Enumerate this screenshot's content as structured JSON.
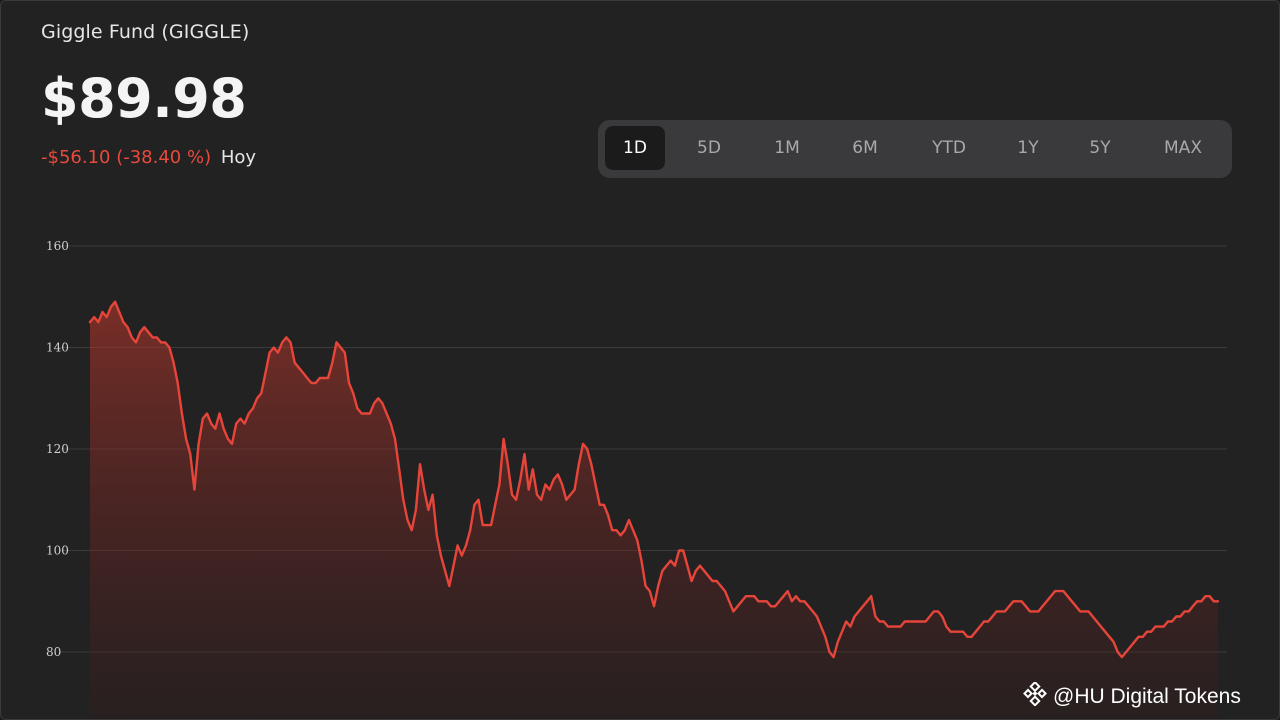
{
  "header": {
    "fund_name": "Giggle Fund (GIGGLE)",
    "price": "$89.98",
    "change": "-$56.10 (-38.40 %)",
    "period": "Hoy"
  },
  "ranges": [
    {
      "label": "1D",
      "active": true
    },
    {
      "label": "5D",
      "active": false
    },
    {
      "label": "1M",
      "active": false
    },
    {
      "label": "6M",
      "active": false
    },
    {
      "label": "YTD",
      "active": false
    },
    {
      "label": "1Y",
      "active": false
    },
    {
      "label": "5Y",
      "active": false
    },
    {
      "label": "MAX",
      "active": false
    }
  ],
  "colors": {
    "line": "#e8453a",
    "negative": "#e84a3c",
    "background": "#222223",
    "grid": "#3b3b3d"
  },
  "watermark": {
    "text": "@HU Digital Tokens",
    "icon": "binance-diamond-icon"
  },
  "chart_data": {
    "type": "area",
    "y_ticks": [
      160,
      140,
      120,
      100,
      80
    ],
    "ylim": [
      70,
      163
    ],
    "grid": true,
    "x_axis_labels": false,
    "values": [
      145,
      146,
      145,
      147,
      146,
      148,
      149,
      147,
      145,
      144,
      142,
      141,
      143,
      144,
      143,
      142,
      142,
      141,
      141,
      140,
      137,
      133,
      127,
      122,
      119,
      112,
      121,
      126,
      127,
      125,
      124,
      127,
      124,
      122,
      121,
      125,
      126,
      125,
      127,
      128,
      130,
      131,
      135,
      139,
      140,
      139,
      141,
      142,
      141,
      137,
      136,
      135,
      134,
      133,
      133,
      134,
      134,
      134,
      137,
      141,
      140,
      139,
      133,
      131,
      128,
      127,
      127,
      127,
      129,
      130,
      129,
      127,
      125,
      122,
      116,
      110,
      106,
      104,
      108,
      117,
      112,
      108,
      111,
      103,
      99,
      96,
      93,
      97,
      101,
      99,
      101,
      104,
      109,
      110,
      105,
      105,
      105,
      109,
      113,
      122,
      117,
      111,
      110,
      114,
      119,
      112,
      116,
      111,
      110,
      113,
      112,
      114,
      115,
      113,
      110,
      111,
      112,
      117,
      121,
      120,
      117,
      113,
      109,
      109,
      107,
      104,
      104,
      103,
      104,
      106,
      104,
      102,
      98,
      93,
      92,
      89,
      93,
      96,
      97,
      98,
      97,
      100,
      100,
      97,
      94,
      96,
      97,
      96,
      95,
      94,
      94,
      93,
      92,
      90,
      88,
      89,
      90,
      91,
      91,
      91,
      90,
      90,
      90,
      89,
      89,
      90,
      91,
      92,
      90,
      91,
      90,
      90,
      89,
      88,
      87,
      85,
      83,
      80,
      79,
      82,
      84,
      86,
      85,
      87,
      88,
      89,
      90,
      91,
      87,
      86,
      86,
      85,
      85,
      85,
      85,
      86,
      86,
      86,
      86,
      86,
      86,
      87,
      88,
      88,
      87,
      85,
      84,
      84,
      84,
      84,
      83,
      83,
      84,
      85,
      86,
      86,
      87,
      88,
      88,
      88,
      89,
      90,
      90,
      90,
      89,
      88,
      88,
      88,
      89,
      90,
      91,
      92,
      92,
      92,
      91,
      90,
      89,
      88,
      88,
      88,
      87,
      86,
      85,
      84,
      83,
      82,
      80,
      79,
      80,
      81,
      82,
      83,
      83,
      84,
      84,
      85,
      85,
      85,
      86,
      86,
      87,
      87,
      88,
      88,
      89,
      90,
      90,
      91,
      91,
      90,
      90
    ]
  }
}
